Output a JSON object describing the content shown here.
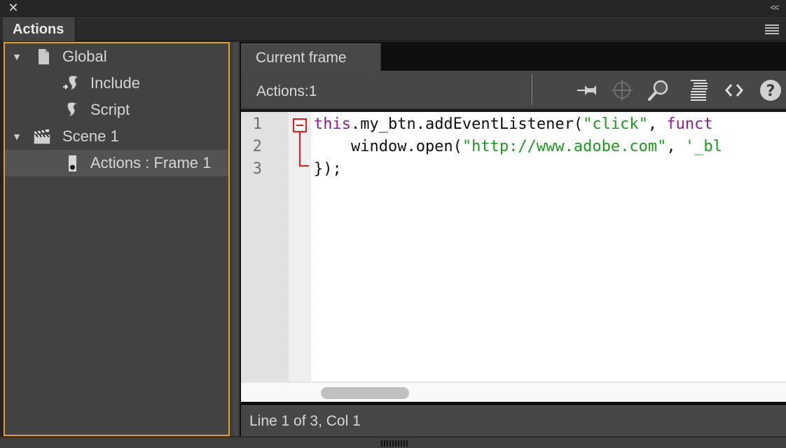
{
  "window": {
    "close_icon": "close-icon",
    "collapse_icon": "double-chevron-left-icon"
  },
  "panel": {
    "tab_label": "Actions",
    "menu_icon": "hamburger-menu-icon"
  },
  "tree": {
    "items": [
      {
        "label": "Global",
        "icon": "document-icon",
        "expanded": true,
        "level": 0
      },
      {
        "label": "Include",
        "icon": "include-script-icon",
        "level": 1
      },
      {
        "label": "Script",
        "icon": "script-scroll-icon",
        "level": 1
      },
      {
        "label": "Scene 1",
        "icon": "clapperboard-icon",
        "expanded": true,
        "level": 0
      },
      {
        "label": "Actions : Frame 1",
        "icon": "frame-keyframe-icon",
        "level": 1,
        "selected": true
      }
    ]
  },
  "editor": {
    "tab_label": "Current frame",
    "toolbar_label": "Actions:1",
    "toolbar_buttons": [
      {
        "name": "pin-script",
        "icon": "pin-icon"
      },
      {
        "name": "insert-target-path",
        "icon": "crosshair-icon",
        "disabled": true
      },
      {
        "name": "find",
        "icon": "magnifier-icon"
      },
      {
        "name": "format-code",
        "icon": "format-lines-icon"
      },
      {
        "name": "code-snippets",
        "icon": "angle-brackets-icon"
      },
      {
        "name": "help",
        "icon": "question-mark-icon"
      }
    ],
    "code_lines": [
      {
        "number": "1",
        "tokens": [
          {
            "t": "this",
            "c": "kw"
          },
          {
            "t": ".my_btn.addEventListener(",
            "c": ""
          },
          {
            "t": "\"click\"",
            "c": "str"
          },
          {
            "t": ", ",
            "c": ""
          },
          {
            "t": "funct",
            "c": "kw"
          }
        ]
      },
      {
        "number": "2",
        "tokens": [
          {
            "t": "    window.open(",
            "c": ""
          },
          {
            "t": "\"http://www.adobe.com\"",
            "c": "str"
          },
          {
            "t": ", ",
            "c": ""
          },
          {
            "t": "'_bl",
            "c": "str"
          }
        ]
      },
      {
        "number": "3",
        "tokens": [
          {
            "t": "});",
            "c": ""
          }
        ]
      }
    ],
    "status": "Line 1 of 3, Col 1"
  },
  "colors": {
    "focus_border": "#e3a021",
    "keyword": "#8b1f8f",
    "string": "#1a9a1a",
    "fold_marker": "#e81a1a"
  }
}
